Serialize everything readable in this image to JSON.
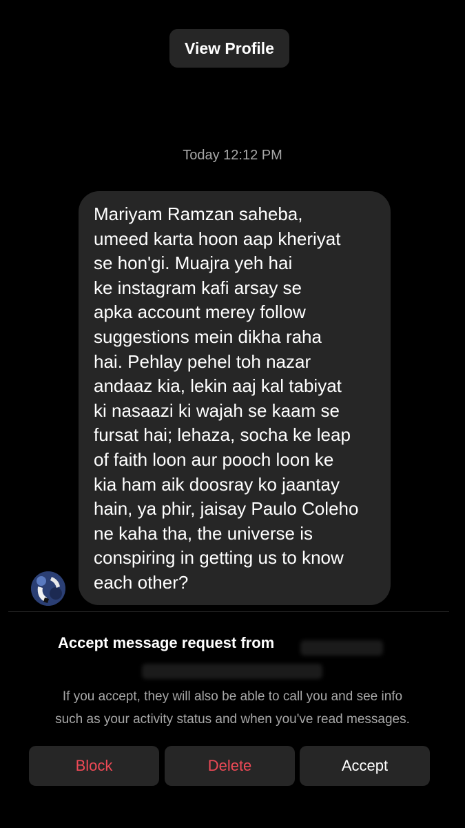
{
  "header": {
    "username_partial": "",
    "view_profile_label": "View Profile"
  },
  "thread": {
    "timestamp": "Today 12:12 PM",
    "message_lines": [
      "Mariyam Ramzan saheba,",
      "umeed karta hoon aap kheriyat",
      "se hon'gi. Muajra yeh hai",
      "ke instagram kafi arsay se",
      "apka account merey follow",
      "suggestions mein dikha raha",
      "hai. Pehlay pehel toh nazar",
      "andaaz kia, lekin aaj kal tabiyat",
      "ki nasaazi ki wajah se kaam se",
      "fursat hai; lehaza, socha ke leap",
      "of faith loon aur pooch loon ke",
      "kia ham aik doosray ko jaantay",
      "hain, ya phir, jaisay Paulo Coleho",
      "ne kaha tha, the universe is",
      "conspiring in getting us to know",
      "each other?"
    ],
    "avatar_icon": "profile-avatar"
  },
  "request_panel": {
    "title": "Accept message request from",
    "description_line1": "If you accept, they will also be able to call you and see info",
    "description_line2": "such as your activity status and when you've read messages."
  },
  "actions": {
    "block_label": "Block",
    "delete_label": "Delete",
    "accept_label": "Accept"
  },
  "colors": {
    "background": "#000000",
    "surface": "#262626",
    "danger": "#ed4956",
    "muted_text": "#a8a8a8"
  }
}
